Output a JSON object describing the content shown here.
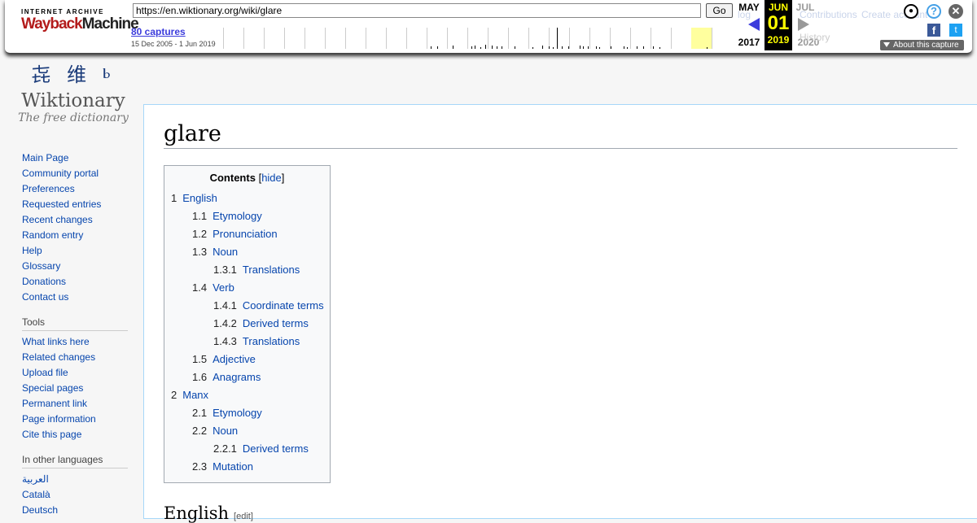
{
  "wayback": {
    "logo_top": "INTERNET ARCHIVE",
    "logo_main_a": "Wayback",
    "logo_main_b": "Machine",
    "url": "https://en.wiktionary.org/wiki/glare",
    "go_label": "Go",
    "captures": "80 captures",
    "range": "15 Dec 2005 - 1 Jun 2019",
    "prev_month": "MAY",
    "prev_year": "2017",
    "cur_month": "JUN",
    "cur_day": "01",
    "cur_year": "2019",
    "next_month": "JUL",
    "next_year": "2020",
    "about": "About this capture",
    "help_glyph": "?",
    "close_glyph": "✕",
    "fb_glyph": "f",
    "tw_glyph": "t"
  },
  "behind_toolbar": {
    "login": "log",
    "contributions": "Contributions",
    "create_account": "Create account",
    "tab_history": "History"
  },
  "logo": {
    "glyphs": "㐂 维 ⱃ",
    "wordmark": "Wiktionary",
    "tagline": "The free dictionary"
  },
  "navigation": [
    "Main Page",
    "Community portal",
    "Preferences",
    "Requested entries",
    "Recent changes",
    "Random entry",
    "Help",
    "Glossary",
    "Donations",
    "Contact us"
  ],
  "tools": {
    "heading": "Tools",
    "items": [
      "What links here",
      "Related changes",
      "Upload file",
      "Special pages",
      "Permanent link",
      "Page information",
      "Cite this page"
    ]
  },
  "languages": {
    "heading": "In other languages",
    "items": [
      "العربية",
      "Català",
      "Deutsch"
    ]
  },
  "page": {
    "title": "glare",
    "next_heading": "English",
    "edit_label": "[edit]"
  },
  "toc": {
    "title": "Contents",
    "hide": "hide",
    "items": [
      {
        "num": "1",
        "text": "English",
        "level": 1
      },
      {
        "num": "1.1",
        "text": "Etymology",
        "level": 2
      },
      {
        "num": "1.2",
        "text": "Pronunciation",
        "level": 2
      },
      {
        "num": "1.3",
        "text": "Noun",
        "level": 2
      },
      {
        "num": "1.3.1",
        "text": "Translations",
        "level": 3
      },
      {
        "num": "1.4",
        "text": "Verb",
        "level": 2
      },
      {
        "num": "1.4.1",
        "text": "Coordinate terms",
        "level": 3
      },
      {
        "num": "1.4.2",
        "text": "Derived terms",
        "level": 3
      },
      {
        "num": "1.4.3",
        "text": "Translations",
        "level": 3
      },
      {
        "num": "1.5",
        "text": "Adjective",
        "level": 2
      },
      {
        "num": "1.6",
        "text": "Anagrams",
        "level": 2
      },
      {
        "num": "2",
        "text": "Manx",
        "level": 1
      },
      {
        "num": "2.1",
        "text": "Etymology",
        "level": 2
      },
      {
        "num": "2.2",
        "text": "Noun",
        "level": 2
      },
      {
        "num": "2.2.1",
        "text": "Derived terms",
        "level": 3
      },
      {
        "num": "2.3",
        "text": "Mutation",
        "level": 2
      }
    ]
  }
}
